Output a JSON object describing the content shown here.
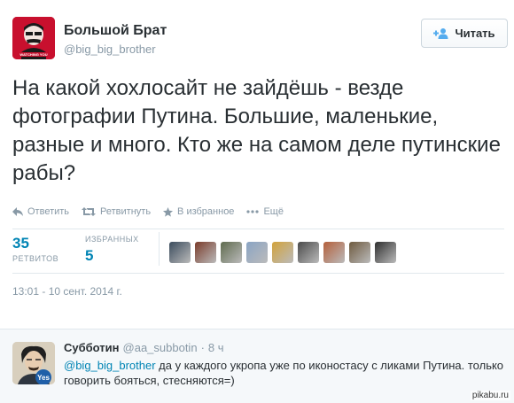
{
  "author": {
    "name": "Большой Брат",
    "handle": "@big_big_brother",
    "avatar_icon": "big-brother-watching-you-logo",
    "avatar_color": "#c8102e"
  },
  "follow_button": {
    "label": "Читать",
    "icon": "add-user-icon"
  },
  "tweet": {
    "text": "На какой хохлосайт не зайдёшь - везде фотографии Путина. Большие, маленькие, разные и много. Кто же на самом деле путинские рабы?"
  },
  "actions": {
    "reply": "Ответить",
    "retweet": "Ретвитнуть",
    "favorite": "В избранное",
    "more": "Ещё"
  },
  "stats": {
    "retweets_count": "35",
    "retweets_label": "РЕТВИТОВ",
    "favorites_label": "ИЗБРАННЫХ",
    "favorites_count": "5"
  },
  "favoriters": [
    {
      "name": "favoriter-1",
      "color": "#3a4b5c"
    },
    {
      "name": "favoriter-2",
      "color": "#7a3b2a"
    },
    {
      "name": "favoriter-3",
      "color": "#5f6b4e"
    },
    {
      "name": "favoriter-4",
      "color": "#8aa4c4"
    },
    {
      "name": "favoriter-5",
      "color": "#d2a23a"
    },
    {
      "name": "favoriter-6",
      "color": "#4a4a4a"
    },
    {
      "name": "favoriter-7",
      "color": "#b45f3a"
    },
    {
      "name": "favoriter-8",
      "color": "#6e5a3e"
    },
    {
      "name": "favoriter-9",
      "color": "#2e2e2e"
    }
  ],
  "timestamp": "13:01 - 10 сент. 2014 г.",
  "reply": {
    "name": "Субботин",
    "handle": "@aa_subbotin",
    "separator": "·",
    "time": "8 ч",
    "mention": "@big_big_brother",
    "text": " да у каждого укропа уже по иконостасу с ликами Путина. только говорить бояться, стесняются=)",
    "badge_text": "Yes"
  },
  "watermark": "pikabu.ru",
  "colors": {
    "link": "#0084b4",
    "muted": "#8899a6",
    "text": "#292f33"
  }
}
